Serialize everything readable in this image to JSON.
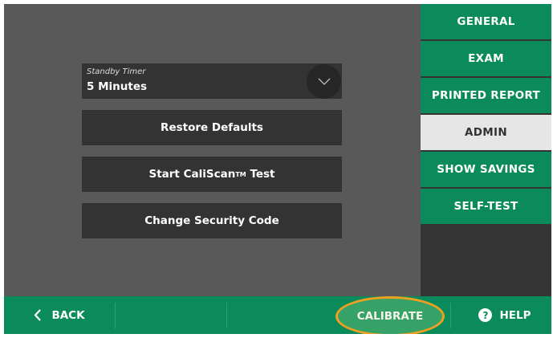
{
  "main": {
    "standby_timer": {
      "label": "Standby Timer",
      "value": "5 Minutes",
      "icon": "chevron-down-icon"
    },
    "restore_defaults_label": "Restore Defaults",
    "caliscan_prefix": "Start CaliScan",
    "caliscan_tm": "TM",
    "caliscan_suffix": "Test",
    "change_code_label": "Change Security Code"
  },
  "sidebar": {
    "tabs": [
      {
        "label": "GENERAL",
        "active": false
      },
      {
        "label": "EXAM",
        "active": false
      },
      {
        "label": "PRINTED REPORT",
        "active": false
      },
      {
        "label": "ADMIN",
        "active": true
      },
      {
        "label": "SHOW SAVINGS",
        "active": false
      },
      {
        "label": "SELF-TEST",
        "active": false
      }
    ]
  },
  "bottom_bar": {
    "back_label": "BACK",
    "back_icon": "chevron-left-icon",
    "calibrate_label": "CALIBRATE",
    "help_label": "HELP",
    "help_icon": "question-icon",
    "help_glyph": "?"
  },
  "colors": {
    "accent_green": "#0b8a5c",
    "highlight_ring": "#f0a020",
    "active_tab": "#e6e6e6",
    "button_dark": "#333333",
    "panel_gray": "#595959"
  }
}
